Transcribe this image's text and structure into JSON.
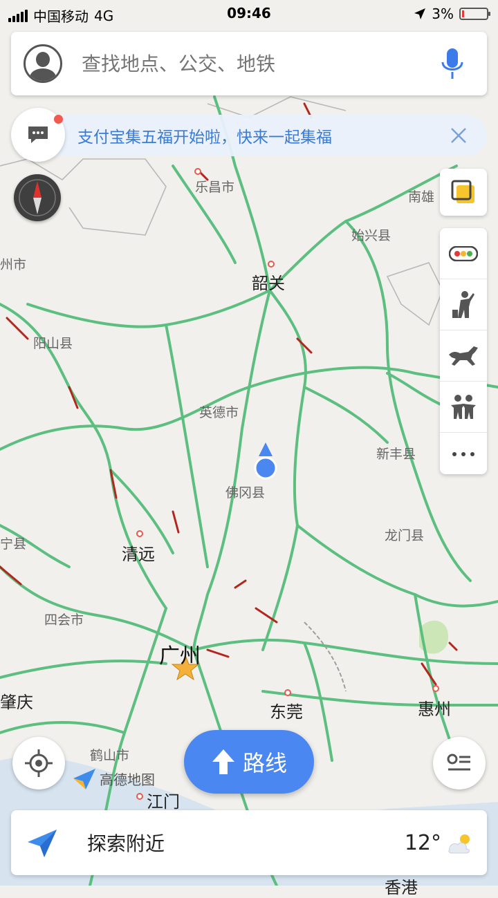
{
  "status_bar": {
    "carrier": "中国移动",
    "network": "4G",
    "time": "09:46",
    "battery": "3%",
    "battery_color": "#e53935"
  },
  "search": {
    "placeholder": "查找地点、公交、地铁",
    "avatar_icon": "user-avatar-icon",
    "mic_icon": "microphone-icon"
  },
  "notice": {
    "text": "支付宝集五福开始啦，快来一起集福",
    "message_icon": "chat-bubble-icon",
    "close_icon": "close-icon"
  },
  "map": {
    "road_color": "#5cbf80",
    "congestion_color": "#b3261e",
    "labels": {
      "lechang": "乐昌市",
      "nanxiong": "南雄",
      "shixing": "始兴县",
      "shaoguan": "韶关",
      "yangshan": "阳山县",
      "yingde": "英德市",
      "xinfeng": "新丰县",
      "fogang": "佛冈县",
      "longmen": "龙门县",
      "qingyuan": "清远",
      "sihui": "四会市",
      "guangzhou": "广州",
      "dongguan": "东莞",
      "huizhou": "惠州",
      "heshan": "鹤山市",
      "jiangmen": "江门",
      "zhaoqing": "肇庆",
      "lianzhou_partial": "州市",
      "guangning_partial": "宁县",
      "xiangang_partial": "香港"
    }
  },
  "tools": [
    "layers-icon",
    "traffic-icon",
    "street-view-icon",
    "horse-icon",
    "people-icon",
    "more-icon"
  ],
  "buttons": {
    "route": "路线",
    "route_icon": "arrow-up-icon",
    "locate_icon": "locate-icon",
    "list_icon": "list-icon",
    "logo": "高德地图"
  },
  "nearby": {
    "text": "探索附近",
    "temperature": "12°",
    "weather_icon": "partly-cloudy-icon",
    "nearby_icon": "paper-plane-icon"
  },
  "accent": "#4a87f0"
}
